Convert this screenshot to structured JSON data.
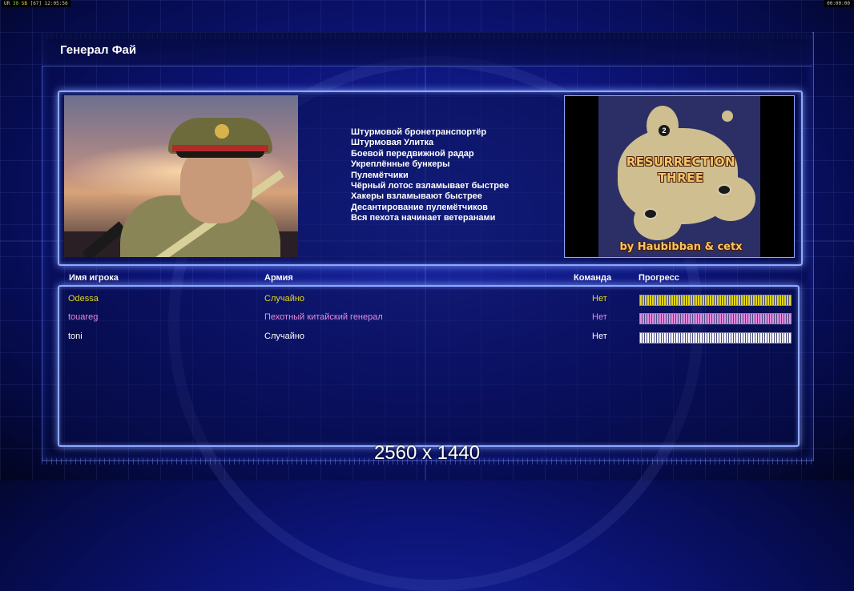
{
  "status_bar": {
    "left_prefix": "UR",
    "fps_green": "30",
    "fps_yellow": "SB",
    "bracket": "[67]",
    "clock": "12:05:56",
    "right_clock": "00:00:00"
  },
  "screen_title": "Генерал Фай",
  "general_upgrades": [
    "Штурмовой бронетранспортёр",
    "Штурмовая Улитка",
    "Боевой передвижной радар",
    "Укреплённые бункеры",
    "Пулемётчики",
    "Чёрный лотос взламывает быстрее",
    "Хакеры взламывают быстрее",
    "Десантирование пулемётчиков",
    "Вся пехота начинает ветеранами"
  ],
  "map_preview": {
    "title_line1": "RESURRECTION",
    "title_line2": "THREE",
    "author": "by Haubibban & cetx",
    "player_marker": "2"
  },
  "players_table": {
    "headers": {
      "name": "Имя игрока",
      "army": "Армия",
      "team": "Команда",
      "progress": "Прогресс"
    },
    "rows": [
      {
        "name": "Odessa",
        "army": "Случайно",
        "team": "Нет",
        "progress": 1.0,
        "color": "#e2d81e"
      },
      {
        "name": "touareg",
        "army": "Пехотный китайский генерал",
        "team": "Нет",
        "progress": 1.0,
        "color": "#e38ee0"
      },
      {
        "name": "toni",
        "army": "Случайно",
        "team": "Нет",
        "progress": 1.0,
        "color": "#ffffff"
      }
    ]
  },
  "resolution_label": "2560 x 1440",
  "colors": {
    "background": "#0c1478",
    "panel_border": "#8ea8ff",
    "map_text": "#f2c56a"
  }
}
